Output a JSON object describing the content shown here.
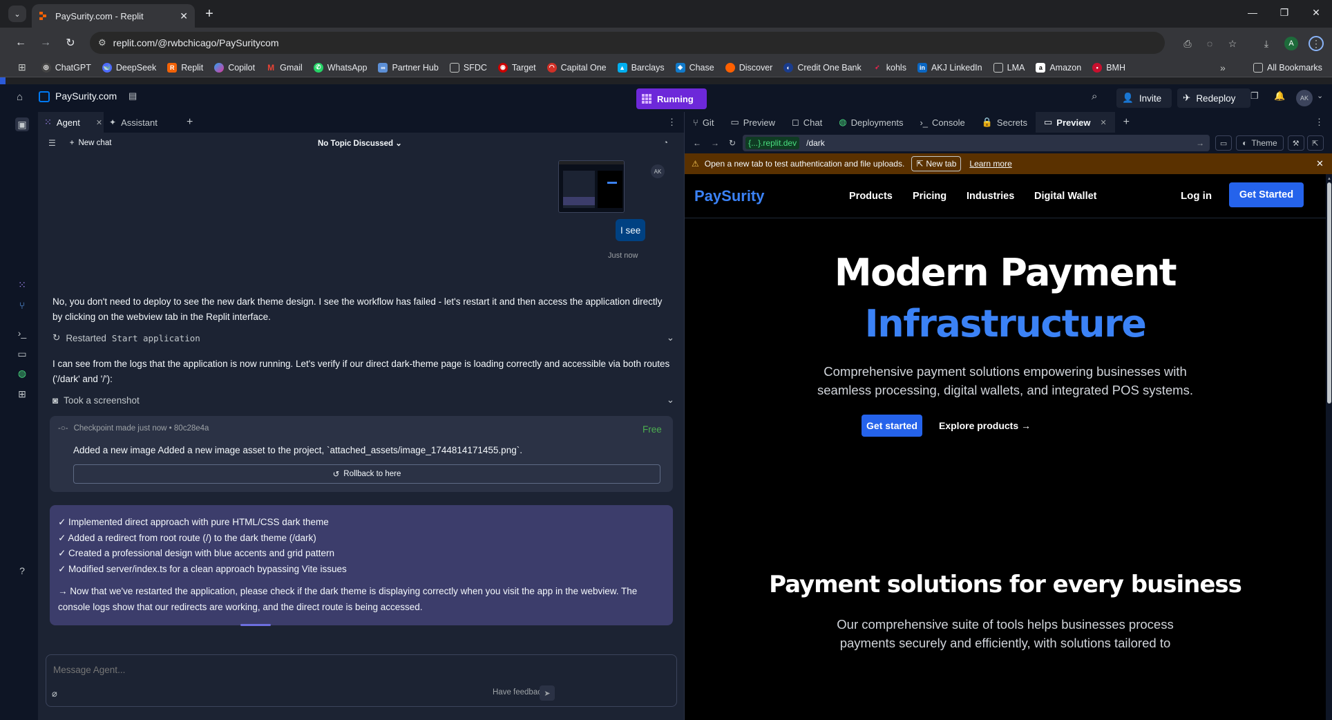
{
  "browser": {
    "tab_title": "PaySurity.com - Replit",
    "url": "replit.com/@rwbchicago/PaySuritycom",
    "bookmarks": [
      "ChatGPT",
      "DeepSeek",
      "Replit",
      "Copilot",
      "Gmail",
      "WhatsApp",
      "Partner Hub",
      "SFDC",
      "Target",
      "Capital One",
      "Barclays",
      "Chase",
      "Discover",
      "Credit One Bank",
      "kohls",
      "AKJ LinkedIn",
      "LMA",
      "Amazon",
      "BMH"
    ],
    "all_bookmarks": "All Bookmarks",
    "profile_initial": "A"
  },
  "replit": {
    "project_name": "PaySurity.com",
    "run_status": "Running",
    "invite_label": "Invite",
    "redeploy_label": "Redeploy",
    "avatar_initials": "AK"
  },
  "agent_panel": {
    "tabs": [
      "Agent",
      "Assistant"
    ],
    "new_chat": "New chat",
    "topic": "No Topic Discussed",
    "user_reply": "I see",
    "user_reply_time": "Just now",
    "user_avatar": "AK",
    "msg1": "No, you don't need to deploy to see the new dark theme design. I see the workflow has failed - let's restart it and then access the application directly by clicking on the webview tab in the Replit interface.",
    "action1_prefix": "Restarted",
    "action1_code": "Start application",
    "msg2": "I can see from the logs that the application is now running. Let's verify if our direct dark-theme page is loading correctly and accessible via both routes ('/dark' and '/'):",
    "action2": "Took a screenshot",
    "checkpoint": {
      "meta": "Checkpoint made just now • 80c28e4a",
      "price": "Free",
      "description": "Added a new image Added a new image asset to the project, `attached_assets/image_1744814171455.png`.",
      "rollback": "Rollback to here"
    },
    "summary_items": [
      "✓ Implemented direct approach with pure HTML/CSS dark theme",
      "✓ Added a redirect from root route (/) to the dark theme (/dark)",
      "✓ Created a professional design with blue accents and grid pattern",
      "✓ Modified server/index.ts for a clean approach bypassing Vite issues"
    ],
    "summary_followup": "→ Now that we've restarted the application, please check if the dark theme is displaying correctly when you visit the app in the webview. The console logs show that our redirects are working, and the direct route is being accessed.",
    "composer_placeholder": "Message Agent...",
    "feedback": "Have feedback?"
  },
  "right_pane": {
    "tabs": [
      "Git",
      "Preview",
      "Chat",
      "Deployments",
      "Console",
      "Secrets",
      "Preview"
    ],
    "domain_chip": "{...}.replit.dev",
    "path": "/dark",
    "theme_label": "Theme",
    "warning": "Open a new tab to test authentication and file uploads.",
    "new_tab": "New tab",
    "learn_more": "Learn more"
  },
  "site": {
    "brand": "PaySurity",
    "nav": [
      "Products",
      "Pricing",
      "Industries",
      "Digital Wallet"
    ],
    "login": "Log in",
    "cta_top": "Get Started",
    "hero_line1": "Modern Payment",
    "hero_line2": "Infrastructure",
    "hero_sub": "Comprehensive payment solutions empowering businesses with seamless processing, digital wallets, and integrated POS systems.",
    "btn_primary": "Get started",
    "btn_secondary": "Explore products →",
    "section_title": "Payment solutions for every business",
    "section_sub": "Our comprehensive suite of tools helps businesses process payments securely and efficiently, with solutions tailored to"
  },
  "colors": {
    "accent_blue": "#2563eb",
    "hero_blue": "#3b82f6",
    "running_purple": "#6d28d9",
    "free_green": "#4caf50",
    "warning_bg": "#5a3100"
  }
}
